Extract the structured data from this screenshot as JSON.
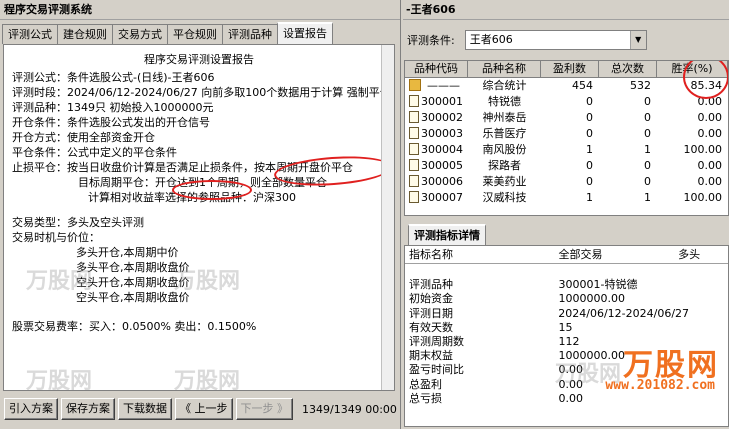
{
  "left_window": {
    "title": "程序交易评测系统",
    "tabs": [
      "评测公式",
      "建仓规则",
      "交易方式",
      "平仓规则",
      "评测品种",
      "设置报告"
    ],
    "active_tab": "设置报告",
    "report": {
      "title": "程序交易评测设置报告",
      "lines": [
        "评测公式：条件选股公式-(日线)-王者606",
        "评测时段：2024/06/12-2024/06/27  向前多取100个数据用于计算 强制平仓",
        "评测品种：1349只  初始投入1000000元",
        "开仓条件：条件选股公式发出的开仓信号",
        "开仓方式：使用全部资金开仓",
        "平仓条件：公式中定义的平仓条件",
        "止损平仓：按当日收盘价计算是否满足止损条件，按本周期开盘价平仓"
      ],
      "indent_lines": [
        "目标周期平仓：开仓达到1个周期，则全部数量平仓",
        "计算相对收益率选择的参照品种：沪深300"
      ],
      "trade_type": "交易类型：多头及空头评测",
      "trade_timing_label": "交易时机与价位：",
      "timing_lines": [
        "多头开仓,本周期中价",
        "多头平仓,本周期收盘价",
        "空头开仓,本周期收盘价",
        "空头平仓,本周期收盘价"
      ],
      "fee_line": "股票交易费率：买入：0.0500%  卖出：0.1500%"
    },
    "buttons": {
      "import": "引入方案",
      "save": "保存方案",
      "download": "下载数据",
      "prev": "《 上一步",
      "next": "下一步 》"
    },
    "page_indicator": "1349/1349  00:00"
  },
  "right_window": {
    "title": "-王者606",
    "condition_label": "评测条件:",
    "condition_value": "王者606",
    "table": {
      "headers": [
        "品种代码",
        "品种名称",
        "盈利数",
        "总次数",
        "胜率(%)"
      ],
      "rows": [
        {
          "code": "———",
          "name": "综合统计",
          "win": "454",
          "total": "532",
          "rate": "85.34"
        },
        {
          "code": "300001",
          "name": "特锐德",
          "win": "0",
          "total": "0",
          "rate": "0.00"
        },
        {
          "code": "300002",
          "name": "神州泰岳",
          "win": "0",
          "total": "0",
          "rate": "0.00"
        },
        {
          "code": "300003",
          "name": "乐普医疗",
          "win": "0",
          "total": "0",
          "rate": "0.00"
        },
        {
          "code": "300004",
          "name": "南风股份",
          "win": "1",
          "total": "1",
          "rate": "100.00"
        },
        {
          "code": "300005",
          "name": "探路者",
          "win": "0",
          "total": "0",
          "rate": "0.00"
        },
        {
          "code": "300006",
          "name": "莱美药业",
          "win": "0",
          "total": "0",
          "rate": "0.00"
        },
        {
          "code": "300007",
          "name": "汉威科技",
          "win": "1",
          "total": "1",
          "rate": "100.00"
        }
      ]
    },
    "detail_tab": "评测指标详情",
    "detail": {
      "headers": [
        "指标名称",
        "全部交易",
        "多头"
      ],
      "rows": [
        {
          "name": "",
          "all": "",
          "long": ""
        },
        {
          "name": "评测品种",
          "all": "300001-特锐德",
          "long": ""
        },
        {
          "name": "初始资金",
          "all": "1000000.00",
          "long": ""
        },
        {
          "name": "评测日期",
          "all": "2024/06/12-2024/06/27",
          "long": ""
        },
        {
          "name": "有效天数",
          "all": "15",
          "long": ""
        },
        {
          "name": "评测周期数",
          "all": "112",
          "long": ""
        },
        {
          "name": "期末权益",
          "all": "1000000.00",
          "long": ""
        },
        {
          "name": "盈亏时间比",
          "all": "0.00",
          "long": ""
        },
        {
          "name": "总盈利",
          "all": "0.00",
          "long": ""
        },
        {
          "name": "总亏损",
          "all": "0.00",
          "long": ""
        }
      ]
    }
  },
  "watermark": {
    "logo_text": "万股网",
    "url": "www.201082.com"
  },
  "colors": {
    "annotation_red": "#e0201f",
    "watermark_orange": "#f07020"
  }
}
